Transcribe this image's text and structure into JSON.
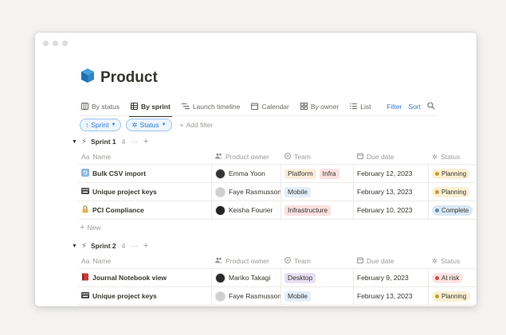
{
  "page": {
    "title": "Product",
    "icon": "cube-icon"
  },
  "views": [
    {
      "label": "By status",
      "icon": "columns-icon",
      "active": false
    },
    {
      "label": "By sprint",
      "icon": "table-icon",
      "active": true
    },
    {
      "label": "Launch timeline",
      "icon": "timeline-icon",
      "active": false
    },
    {
      "label": "Calendar",
      "icon": "calendar-icon",
      "active": false
    },
    {
      "label": "By owner",
      "icon": "grid-icon",
      "active": false
    },
    {
      "label": "List",
      "icon": "list-icon",
      "active": false
    }
  ],
  "actions": {
    "filter": "Filter",
    "sort": "Sort"
  },
  "filters": {
    "sprint": "Sprint",
    "status": "Status",
    "add_filter": "Add filter"
  },
  "columns": {
    "name": "Name",
    "name_prefix": "Aa",
    "owner": "Product owner",
    "team": "Team",
    "due": "Due date",
    "status": "Status"
  },
  "new_label": "New",
  "colors": {
    "Planning": {
      "bg": "#fbf0d3",
      "dot": "#c99a2e"
    },
    "Complete": {
      "bg": "#dbe8f4",
      "dot": "#5b8cb8"
    },
    "At risk": {
      "bg": "#fbe3e1",
      "dot": "#d44c47"
    },
    "Platform": "#faeeda",
    "Infra": "#fbe0df",
    "Infrastructure": "#fbe0df",
    "Mobile": "#e3eef9",
    "Desktop": "#e8e0f2"
  },
  "groups": [
    {
      "name": "Sprint 1",
      "count": "4",
      "rows": [
        {
          "name": "Bulk CSV import",
          "icon": "refresh-icon",
          "owner": "Emma Yoon",
          "teams": [
            "Platform",
            "Infra"
          ],
          "due": "February 12, 2023",
          "status": "Planning"
        },
        {
          "name": "Unique project keys",
          "icon": "keyboard-icon",
          "owner": "Faye Rasmusson",
          "teams": [
            "Mobile"
          ],
          "due": "February 13, 2023",
          "status": "Planning"
        },
        {
          "name": "PCI Compliance",
          "icon": "lock-icon",
          "owner": "Keisha Fourier",
          "teams": [
            "Infrastructure"
          ],
          "due": "February 10, 2023",
          "status": "Complete"
        }
      ]
    },
    {
      "name": "Sprint 2",
      "count": "4",
      "rows": [
        {
          "name": "Journal Notebook view",
          "icon": "notebook-icon",
          "owner": "Mariko Takagi",
          "teams": [
            "Desktop"
          ],
          "due": "February 9, 2023",
          "status": "At risk"
        },
        {
          "name": "Unique project keys",
          "icon": "keyboard-icon",
          "owner": "Faye Rasmusson",
          "teams": [
            "Mobile"
          ],
          "due": "February 13, 2023",
          "status": "Planning"
        }
      ]
    }
  ]
}
